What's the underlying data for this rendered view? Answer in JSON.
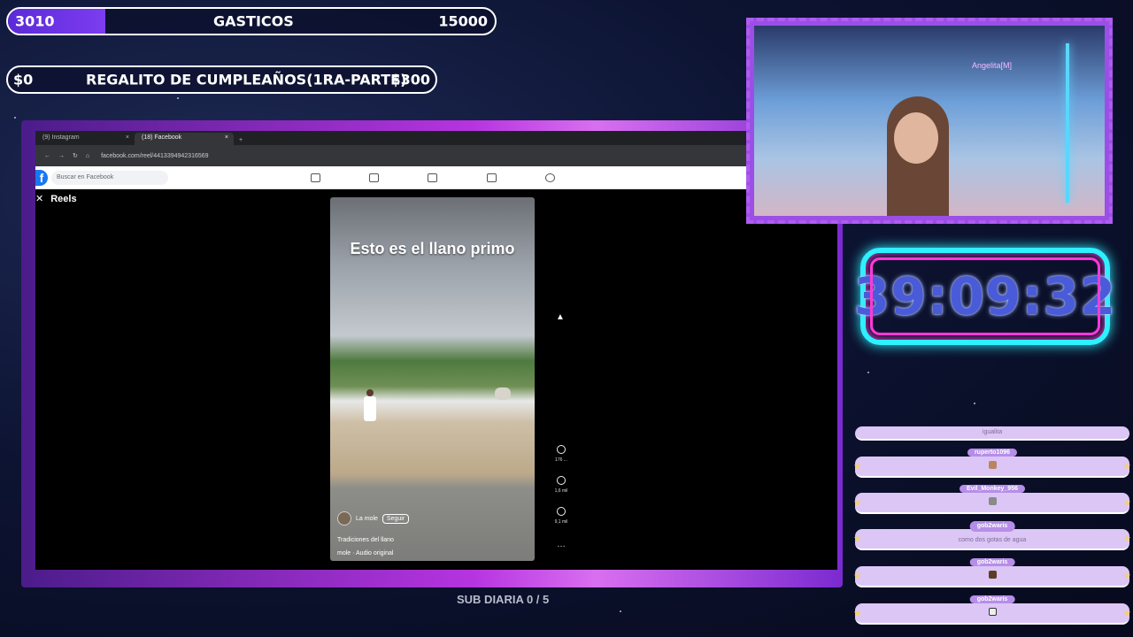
{
  "goal_bar_1": {
    "left": "3010",
    "title": "GASTICOS",
    "right": "15000",
    "progress": 0.2
  },
  "goal_bar_2": {
    "left": "$0",
    "title": "REGALITO DE CUMPLEAÑOS(1RA-PARTE)",
    "right": "$300"
  },
  "browser": {
    "tabs": [
      {
        "label": "(9) Instagram"
      },
      {
        "label": "(18) Facebook"
      }
    ],
    "url": "facebook.com/reel/4413394942316569"
  },
  "facebook": {
    "search_placeholder": "Buscar en Facebook",
    "reels_label": "Reels",
    "reel": {
      "caption": "Esto es el llano primo",
      "author": "La mole",
      "follow_label": "Seguir",
      "description": "Tradiciones del llano",
      "audio": "mole · Audio original",
      "likes": "176 ...",
      "comments": "1,6 mil",
      "shares": "9,1 mil"
    }
  },
  "webcam": {
    "sign": "Angelita[M]"
  },
  "timer": "39:09:32",
  "sub_goal": "SUB DIARIA 0 / 5",
  "chat": [
    {
      "user": "",
      "text": "igualita"
    },
    {
      "user": "ruperto1096",
      "text": ""
    },
    {
      "user": "Evil_Monkey_956",
      "text": ""
    },
    {
      "user": "gob2waris",
      "text": "como dos gotas de agua"
    },
    {
      "user": "gob2waris",
      "text": ""
    },
    {
      "user": "gob2waris",
      "text": ""
    }
  ]
}
